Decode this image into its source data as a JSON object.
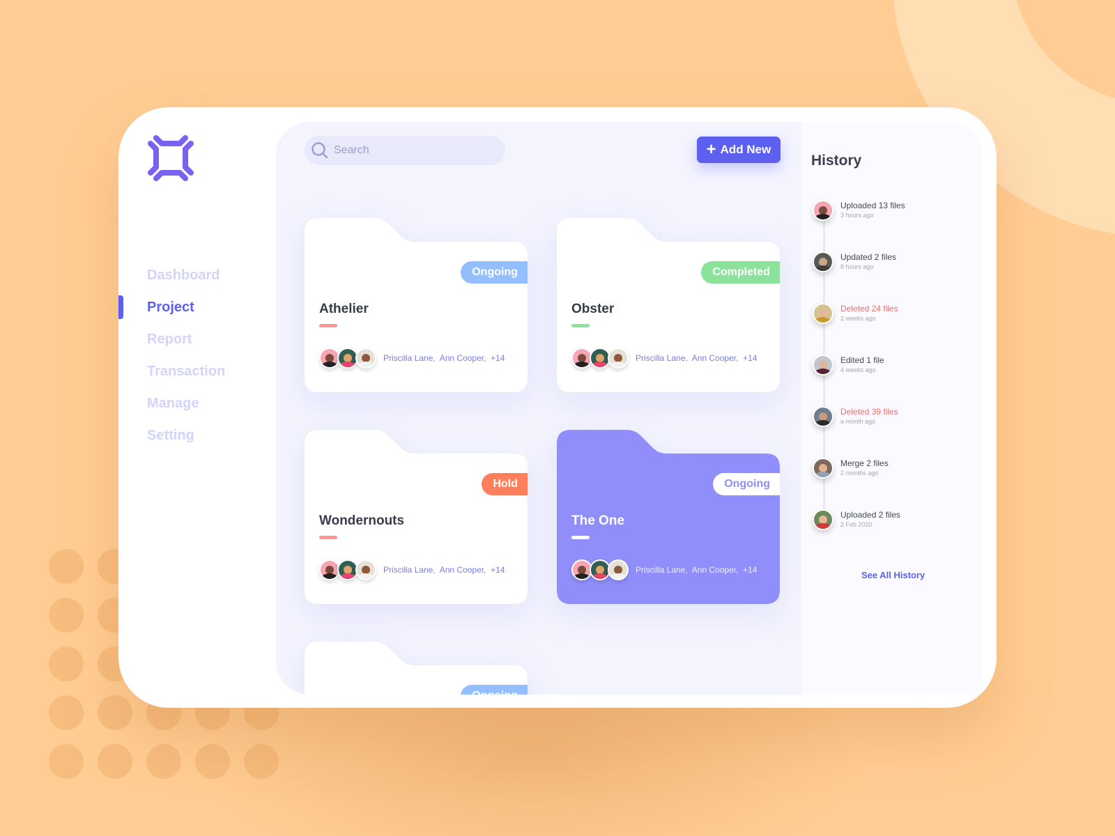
{
  "colors": {
    "accent": "#5D5FEF",
    "background": "#FFCD93",
    "ongoing": "#94BFFF",
    "completed": "#8BE39B",
    "hold": "#FF7F5C",
    "selected_card": "#8F8EFA",
    "deleted_text": "#F26A6A"
  },
  "sidebar": {
    "logo": "logo-icon",
    "items": [
      {
        "label": "Dashboard",
        "active": false
      },
      {
        "label": "Project",
        "active": true
      },
      {
        "label": "Report",
        "active": false
      },
      {
        "label": "Transaction",
        "active": false
      },
      {
        "label": "Manage",
        "active": false
      },
      {
        "label": "Setting",
        "active": false
      }
    ]
  },
  "toolbar": {
    "search_placeholder": "Search",
    "search_icon": "search-icon",
    "add_label": "Add New",
    "add_icon": "plus-icon"
  },
  "projects": [
    {
      "name": "Athelier",
      "status": "Ongoing",
      "members": "Priscilla Lane,  Ann Cooper,  +14",
      "selected": false
    },
    {
      "name": "Obster",
      "status": "Completed",
      "members": "Priscilla Lane,  Ann Cooper,  +14",
      "selected": false
    },
    {
      "name": "Wondernouts",
      "status": "Hold",
      "members": "Priscilla Lane,  Ann Cooper,  +14",
      "selected": false
    },
    {
      "name": "The One",
      "status": "Ongoing",
      "members": "Priscilla Lane,  Ann Cooper,  +14",
      "selected": true
    },
    {
      "name": "",
      "status": "Ongoing",
      "members": "",
      "selected": false
    }
  ],
  "history": {
    "title": "History",
    "items": [
      {
        "action": "Uploaded 13 files",
        "time": "3 hours ago",
        "type": "normal"
      },
      {
        "action": "Updated 2 files",
        "time": "8 hours ago",
        "type": "normal"
      },
      {
        "action": "Deleted 24 files",
        "time": "2 weeks ago",
        "type": "deleted"
      },
      {
        "action": "Edited 1 file",
        "time": "4 weeks ago",
        "type": "normal"
      },
      {
        "action": "Deleted 39 files",
        "time": "a month ago",
        "type": "deleted"
      },
      {
        "action": "Merge 2 files",
        "time": "2 months ago",
        "type": "normal"
      },
      {
        "action": "Uploaded 2 files",
        "time": "2 Feb 2020",
        "type": "normal"
      }
    ],
    "see_all_label": "See All History"
  }
}
